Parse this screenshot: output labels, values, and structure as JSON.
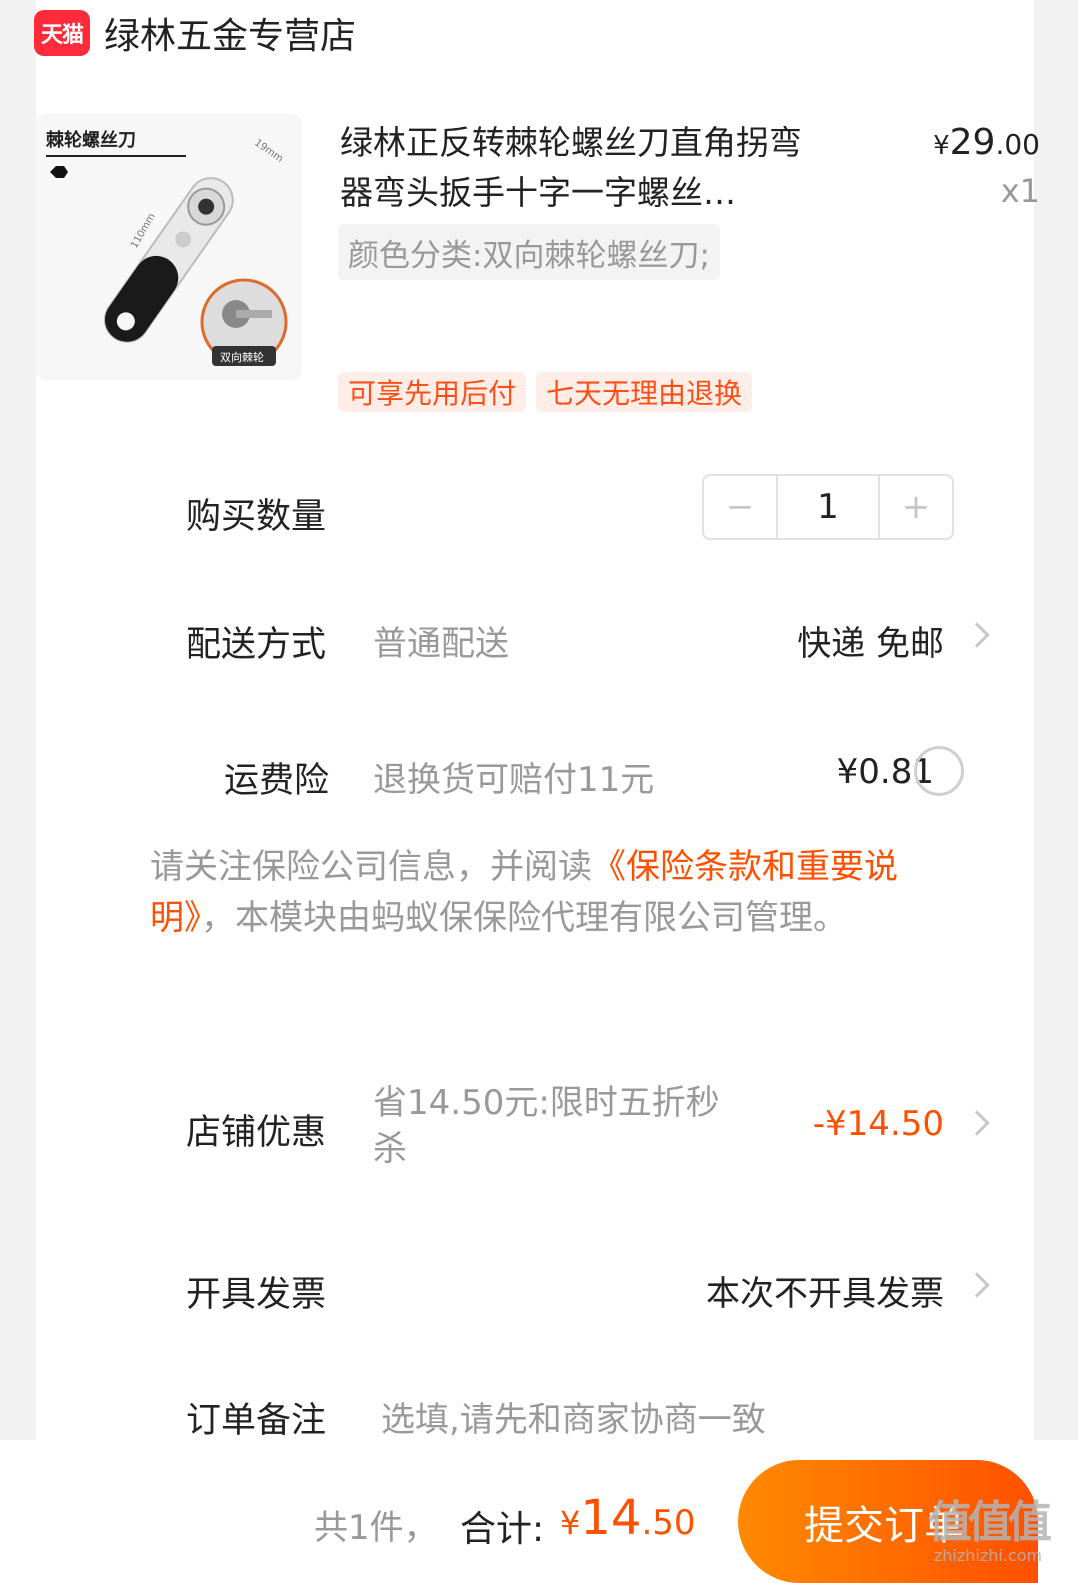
{
  "shop": {
    "badge": "天猫",
    "name": "绿林五金专营店"
  },
  "product": {
    "image_caption": "棘轮螺丝刀",
    "image_dim_length": "110mm",
    "image_dim_head": "19mm",
    "image_badge": "双向棘轮",
    "title": "绿林正反转棘轮螺丝刀直角拐弯器弯头扳手十字一字螺丝…",
    "price_currency": "¥",
    "price_integer": "29",
    "price_decimal": ".00",
    "quantity": "x1",
    "sku": "颜色分类:双向棘轮螺丝刀;",
    "tags": [
      "可享先用后付",
      "七天无理由退换"
    ]
  },
  "buy_quantity": {
    "label": "购买数量",
    "minus": "−",
    "value": "1",
    "plus": "+"
  },
  "delivery": {
    "label": "配送方式",
    "method": "普通配送",
    "value": "快递 免邮"
  },
  "shipping_insurance": {
    "label": "运费险",
    "description": "退换货可赔付11元",
    "price": "¥0.81"
  },
  "notice": {
    "prefix": "请关注保险公司信息，并阅读",
    "link": "《保险条款和重要说明》",
    "suffix": "，本模块由蚂蚁保保险代理有限公司管理。"
  },
  "store_discount": {
    "label": "店铺优惠",
    "description": "省14.50元:限时五折秒杀",
    "value": "-¥14.50"
  },
  "invoice": {
    "label": "开具发票",
    "value": "本次不开具发票"
  },
  "order_note": {
    "label": "订单备注",
    "placeholder": "选填,请先和商家协商一致"
  },
  "footer": {
    "count": "共1件，",
    "total_label": "合计:",
    "total_currency": "¥",
    "total_integer": "14",
    "total_decimal": ".50",
    "submit": "提交订单"
  },
  "watermark": {
    "text": "值值值",
    "url": "zhizhizhi.com"
  },
  "colors": {
    "accent": "#ff5000",
    "tmall_red": "#ff2b3a",
    "tag_bg": "#ffeee8"
  }
}
